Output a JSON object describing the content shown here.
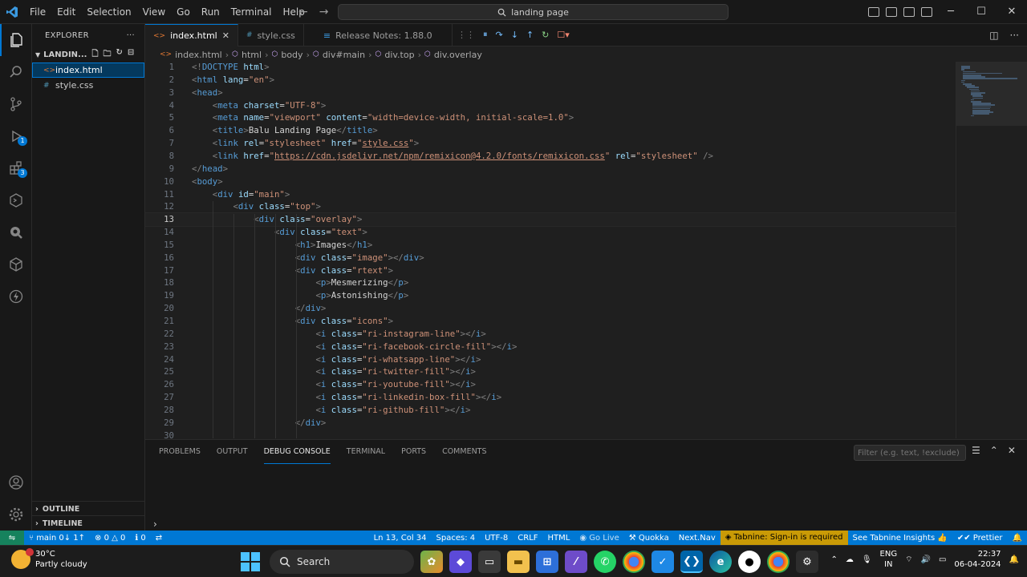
{
  "titlebar": {
    "menus": [
      "File",
      "Edit",
      "Selection",
      "View",
      "Go",
      "Run",
      "Terminal",
      "Help"
    ],
    "command_center": "landing page"
  },
  "sidebar": {
    "title": "EXPLORER",
    "folder": "LANDIN...",
    "files": [
      {
        "name": "index.html",
        "icon": "<>"
      },
      {
        "name": "style.css",
        "icon": "#"
      }
    ],
    "outline": "OUTLINE",
    "timeline": "TIMELINE"
  },
  "activity": {
    "run_badge": "1",
    "extensions_badge": "3"
  },
  "tabs": [
    {
      "label": "index.html",
      "icon": "<>"
    },
    {
      "label": "style.css",
      "icon": "#"
    },
    {
      "label": "Release Notes: 1.88.0",
      "icon": "≡"
    }
  ],
  "breadcrumb": [
    "index.html",
    "html",
    "body",
    "div#main",
    "div.top",
    "div.overlay"
  ],
  "editor": {
    "current_line": 13,
    "lines": [
      {
        "n": "1",
        "code": [
          [
            "g",
            "<!"
          ],
          [
            "t",
            "DOCTYPE"
          ],
          [
            "x",
            " "
          ],
          [
            "a",
            "html"
          ],
          [
            "g",
            ">"
          ]
        ]
      },
      {
        "n": "2",
        "code": [
          [
            "g",
            "<"
          ],
          [
            "t",
            "html"
          ],
          [
            "x",
            " "
          ],
          [
            "a",
            "lang"
          ],
          [
            "x",
            "="
          ],
          [
            "s",
            "\"en\""
          ],
          [
            "g",
            ">"
          ]
        ]
      },
      {
        "n": "3",
        "code": [
          [
            "g",
            "<"
          ],
          [
            "t",
            "head"
          ],
          [
            "g",
            ">"
          ]
        ]
      },
      {
        "n": "4",
        "code": [
          [
            "x",
            "    "
          ],
          [
            "g",
            "<"
          ],
          [
            "t",
            "meta"
          ],
          [
            "x",
            " "
          ],
          [
            "a",
            "charset"
          ],
          [
            "x",
            "="
          ],
          [
            "s",
            "\"UTF-8\""
          ],
          [
            "g",
            ">"
          ]
        ]
      },
      {
        "n": "5",
        "code": [
          [
            "x",
            "    "
          ],
          [
            "g",
            "<"
          ],
          [
            "t",
            "meta"
          ],
          [
            "x",
            " "
          ],
          [
            "a",
            "name"
          ],
          [
            "x",
            "="
          ],
          [
            "s",
            "\"viewport\""
          ],
          [
            "x",
            " "
          ],
          [
            "a",
            "content"
          ],
          [
            "x",
            "="
          ],
          [
            "s",
            "\"width=device-width, initial-scale=1.0\""
          ],
          [
            "g",
            ">"
          ]
        ]
      },
      {
        "n": "6",
        "code": [
          [
            "x",
            "    "
          ],
          [
            "g",
            "<"
          ],
          [
            "t",
            "title"
          ],
          [
            "g",
            ">"
          ],
          [
            "x",
            "Balu Landing Page"
          ],
          [
            "g",
            "</"
          ],
          [
            "t",
            "title"
          ],
          [
            "g",
            ">"
          ]
        ]
      },
      {
        "n": "7",
        "code": [
          [
            "x",
            "    "
          ],
          [
            "g",
            "<"
          ],
          [
            "t",
            "link"
          ],
          [
            "x",
            " "
          ],
          [
            "a",
            "rel"
          ],
          [
            "x",
            "="
          ],
          [
            "s",
            "\"stylesheet\""
          ],
          [
            "x",
            " "
          ],
          [
            "a",
            "href"
          ],
          [
            "x",
            "="
          ],
          [
            "s",
            "\""
          ],
          [
            "u",
            "style.css"
          ],
          [
            "s",
            "\""
          ],
          [
            "g",
            ">"
          ]
        ]
      },
      {
        "n": "8",
        "code": [
          [
            "x",
            "    "
          ],
          [
            "g",
            "<"
          ],
          [
            "t",
            "link"
          ],
          [
            "x",
            " "
          ],
          [
            "a",
            "href"
          ],
          [
            "x",
            "="
          ],
          [
            "s",
            "\""
          ],
          [
            "u",
            "https://cdn.jsdelivr.net/npm/remixicon@4.2.0/fonts/remixicon.css"
          ],
          [
            "s",
            "\""
          ],
          [
            "x",
            " "
          ],
          [
            "a",
            "rel"
          ],
          [
            "x",
            "="
          ],
          [
            "s",
            "\"stylesheet\""
          ],
          [
            "x",
            " "
          ],
          [
            "g",
            "/>"
          ]
        ]
      },
      {
        "n": "9",
        "code": [
          [
            "g",
            "</"
          ],
          [
            "t",
            "head"
          ],
          [
            "g",
            ">"
          ]
        ]
      },
      {
        "n": "10",
        "code": [
          [
            "g",
            "<"
          ],
          [
            "t",
            "body"
          ],
          [
            "g",
            ">"
          ]
        ]
      },
      {
        "n": "11",
        "code": [
          [
            "x",
            "    "
          ],
          [
            "g",
            "<"
          ],
          [
            "t",
            "div"
          ],
          [
            "x",
            " "
          ],
          [
            "a",
            "id"
          ],
          [
            "x",
            "="
          ],
          [
            "s",
            "\"main\""
          ],
          [
            "g",
            ">"
          ]
        ]
      },
      {
        "n": "12",
        "code": [
          [
            "x",
            "        "
          ],
          [
            "g",
            "<"
          ],
          [
            "t",
            "div"
          ],
          [
            "x",
            " "
          ],
          [
            "a",
            "class"
          ],
          [
            "x",
            "="
          ],
          [
            "s",
            "\"top\""
          ],
          [
            "g",
            ">"
          ]
        ]
      },
      {
        "n": "13",
        "code": [
          [
            "x",
            "            "
          ],
          [
            "g",
            "<"
          ],
          [
            "t",
            "div"
          ],
          [
            "x",
            " "
          ],
          [
            "a",
            "class"
          ],
          [
            "x",
            "="
          ],
          [
            "s",
            "\"overlay\""
          ],
          [
            "g",
            ">"
          ]
        ]
      },
      {
        "n": "14",
        "code": [
          [
            "x",
            "                "
          ],
          [
            "g",
            "<"
          ],
          [
            "t",
            "div"
          ],
          [
            "x",
            " "
          ],
          [
            "a",
            "class"
          ],
          [
            "x",
            "="
          ],
          [
            "s",
            "\"text\""
          ],
          [
            "g",
            ">"
          ]
        ]
      },
      {
        "n": "15",
        "code": [
          [
            "x",
            "                    "
          ],
          [
            "g",
            "<"
          ],
          [
            "t",
            "h1"
          ],
          [
            "g",
            ">"
          ],
          [
            "x",
            "Images"
          ],
          [
            "g",
            "</"
          ],
          [
            "t",
            "h1"
          ],
          [
            "g",
            ">"
          ]
        ]
      },
      {
        "n": "16",
        "code": [
          [
            "x",
            "                    "
          ],
          [
            "g",
            "<"
          ],
          [
            "t",
            "div"
          ],
          [
            "x",
            " "
          ],
          [
            "a",
            "class"
          ],
          [
            "x",
            "="
          ],
          [
            "s",
            "\"image\""
          ],
          [
            "g",
            "></"
          ],
          [
            "t",
            "div"
          ],
          [
            "g",
            ">"
          ]
        ]
      },
      {
        "n": "17",
        "code": [
          [
            "x",
            "                    "
          ],
          [
            "g",
            "<"
          ],
          [
            "t",
            "div"
          ],
          [
            "x",
            " "
          ],
          [
            "a",
            "class"
          ],
          [
            "x",
            "="
          ],
          [
            "s",
            "\"rtext\""
          ],
          [
            "g",
            ">"
          ]
        ]
      },
      {
        "n": "18",
        "code": [
          [
            "x",
            "                        "
          ],
          [
            "g",
            "<"
          ],
          [
            "t",
            "p"
          ],
          [
            "g",
            ">"
          ],
          [
            "x",
            "Mesmerizing"
          ],
          [
            "g",
            "</"
          ],
          [
            "t",
            "p"
          ],
          [
            "g",
            ">"
          ]
        ]
      },
      {
        "n": "19",
        "code": [
          [
            "x",
            "                        "
          ],
          [
            "g",
            "<"
          ],
          [
            "t",
            "p"
          ],
          [
            "g",
            ">"
          ],
          [
            "x",
            "Astonishing"
          ],
          [
            "g",
            "</"
          ],
          [
            "t",
            "p"
          ],
          [
            "g",
            ">"
          ]
        ]
      },
      {
        "n": "20",
        "code": [
          [
            "x",
            "                    "
          ],
          [
            "g",
            "</"
          ],
          [
            "t",
            "div"
          ],
          [
            "g",
            ">"
          ]
        ]
      },
      {
        "n": "21",
        "code": [
          [
            "x",
            "                    "
          ],
          [
            "g",
            "<"
          ],
          [
            "t",
            "div"
          ],
          [
            "x",
            " "
          ],
          [
            "a",
            "class"
          ],
          [
            "x",
            "="
          ],
          [
            "s",
            "\"icons\""
          ],
          [
            "g",
            ">"
          ]
        ]
      },
      {
        "n": "22",
        "code": [
          [
            "x",
            "                        "
          ],
          [
            "g",
            "<"
          ],
          [
            "t",
            "i"
          ],
          [
            "x",
            " "
          ],
          [
            "a",
            "class"
          ],
          [
            "x",
            "="
          ],
          [
            "s",
            "\"ri-instagram-line\""
          ],
          [
            "g",
            "></"
          ],
          [
            "t",
            "i"
          ],
          [
            "g",
            ">"
          ]
        ]
      },
      {
        "n": "23",
        "code": [
          [
            "x",
            "                        "
          ],
          [
            "g",
            "<"
          ],
          [
            "t",
            "i"
          ],
          [
            "x",
            " "
          ],
          [
            "a",
            "class"
          ],
          [
            "x",
            "="
          ],
          [
            "s",
            "\"ri-facebook-circle-fill\""
          ],
          [
            "g",
            "></"
          ],
          [
            "t",
            "i"
          ],
          [
            "g",
            ">"
          ]
        ]
      },
      {
        "n": "24",
        "code": [
          [
            "x",
            "                        "
          ],
          [
            "g",
            "<"
          ],
          [
            "t",
            "i"
          ],
          [
            "x",
            " "
          ],
          [
            "a",
            "class"
          ],
          [
            "x",
            "="
          ],
          [
            "s",
            "\"ri-whatsapp-line\""
          ],
          [
            "g",
            "></"
          ],
          [
            "t",
            "i"
          ],
          [
            "g",
            ">"
          ]
        ]
      },
      {
        "n": "25",
        "code": [
          [
            "x",
            "                        "
          ],
          [
            "g",
            "<"
          ],
          [
            "t",
            "i"
          ],
          [
            "x",
            " "
          ],
          [
            "a",
            "class"
          ],
          [
            "x",
            "="
          ],
          [
            "s",
            "\"ri-twitter-fill\""
          ],
          [
            "g",
            "></"
          ],
          [
            "t",
            "i"
          ],
          [
            "g",
            ">"
          ]
        ]
      },
      {
        "n": "26",
        "code": [
          [
            "x",
            "                        "
          ],
          [
            "g",
            "<"
          ],
          [
            "t",
            "i"
          ],
          [
            "x",
            " "
          ],
          [
            "a",
            "class"
          ],
          [
            "x",
            "="
          ],
          [
            "s",
            "\"ri-youtube-fill\""
          ],
          [
            "g",
            "></"
          ],
          [
            "t",
            "i"
          ],
          [
            "g",
            ">"
          ]
        ]
      },
      {
        "n": "27",
        "code": [
          [
            "x",
            "                        "
          ],
          [
            "g",
            "<"
          ],
          [
            "t",
            "i"
          ],
          [
            "x",
            " "
          ],
          [
            "a",
            "class"
          ],
          [
            "x",
            "="
          ],
          [
            "s",
            "\"ri-linkedin-box-fill\""
          ],
          [
            "g",
            "></"
          ],
          [
            "t",
            "i"
          ],
          [
            "g",
            ">"
          ]
        ]
      },
      {
        "n": "28",
        "code": [
          [
            "x",
            "                        "
          ],
          [
            "g",
            "<"
          ],
          [
            "t",
            "i"
          ],
          [
            "x",
            " "
          ],
          [
            "a",
            "class"
          ],
          [
            "x",
            "="
          ],
          [
            "s",
            "\"ri-github-fill\""
          ],
          [
            "g",
            "></"
          ],
          [
            "t",
            "i"
          ],
          [
            "g",
            ">"
          ]
        ]
      },
      {
        "n": "29",
        "code": [
          [
            "x",
            "                    "
          ],
          [
            "g",
            "</"
          ],
          [
            "t",
            "div"
          ],
          [
            "g",
            ">"
          ]
        ]
      },
      {
        "n": "30",
        "code": []
      }
    ]
  },
  "panel": {
    "tabs": [
      "PROBLEMS",
      "OUTPUT",
      "DEBUG CONSOLE",
      "TERMINAL",
      "PORTS",
      "COMMENTS"
    ],
    "active_tab": "DEBUG CONSOLE",
    "filter_placeholder": "Filter (e.g. text, !exclude)"
  },
  "statusbar": {
    "branch": "main",
    "sync": "0↓ 1↑",
    "errors": "0",
    "warnings": "0",
    "info": "0",
    "cursor": "Ln 13, Col 34",
    "spaces": "Spaces: 4",
    "encoding": "UTF-8",
    "eol": "CRLF",
    "language": "HTML",
    "golive": "Go Live",
    "quokka": "Quokka",
    "nextnav": "Next.Nav",
    "tabnine": "Tabnine: Sign-in is required",
    "tabnine_insights": "See Tabnine Insights",
    "prettier": "Prettier"
  },
  "taskbar": {
    "temperature": "30°C",
    "weather": "Partly cloudy",
    "search_label": "Search",
    "lang_top": "ENG",
    "lang_bottom": "IN",
    "time": "22:37",
    "date": "06-04-2024"
  },
  "colors": {
    "accent": "#0078d4",
    "statusbar": "#0078d4",
    "remote": "#16825d",
    "tabnine": "#c99a06"
  }
}
